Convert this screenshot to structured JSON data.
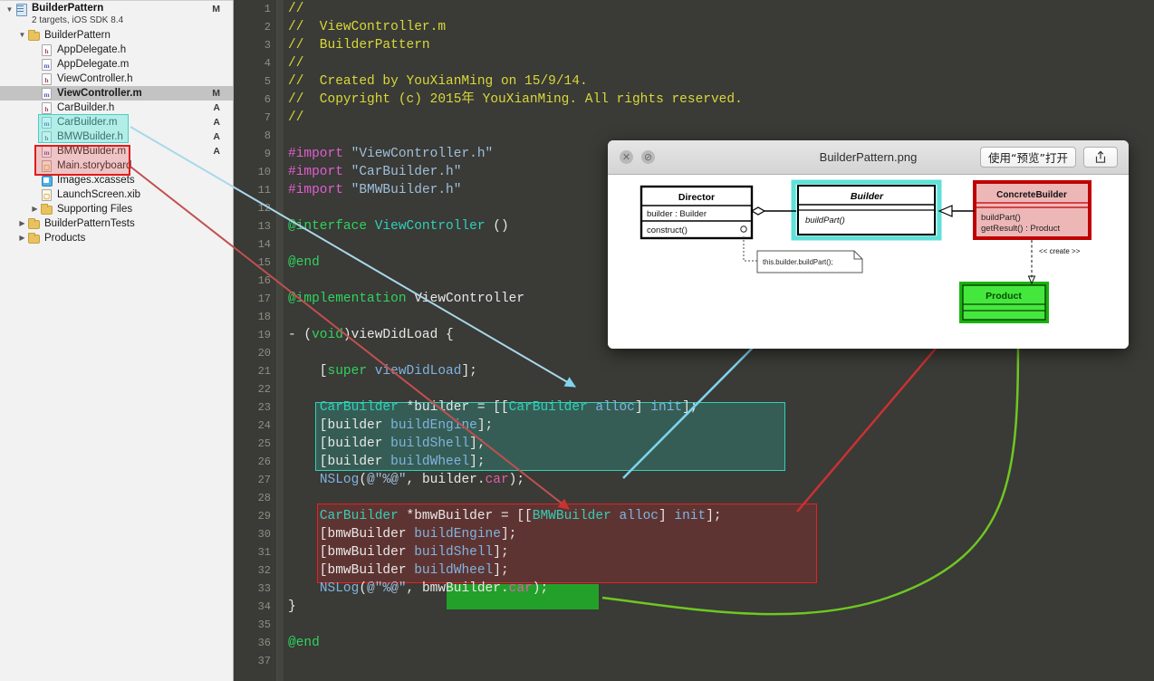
{
  "navigator": {
    "project": {
      "name": "BuilderPattern",
      "subtitle": "2 targets, iOS SDK 8.4",
      "status": "M",
      "icon": "project-icon"
    },
    "items": [
      {
        "label": "BuilderPattern",
        "icon": "folder-icon",
        "indent": 1,
        "status": "",
        "disclosure": "down",
        "selected": false
      },
      {
        "label": "AppDelegate.h",
        "icon": "header-file-icon",
        "indent": 2,
        "status": "",
        "disclosure": "",
        "selected": false
      },
      {
        "label": "AppDelegate.m",
        "icon": "method-file-icon",
        "indent": 2,
        "status": "",
        "disclosure": "",
        "selected": false
      },
      {
        "label": "ViewController.h",
        "icon": "header-file-icon",
        "indent": 2,
        "status": "",
        "disclosure": "",
        "selected": false
      },
      {
        "label": "ViewController.m",
        "icon": "method-file-icon",
        "indent": 2,
        "status": "M",
        "disclosure": "",
        "selected": true
      },
      {
        "label": "CarBuilder.h",
        "icon": "header-file-icon",
        "indent": 2,
        "status": "A",
        "disclosure": "",
        "selected": false
      },
      {
        "label": "CarBuilder.m",
        "icon": "method-file-icon",
        "indent": 2,
        "status": "A",
        "disclosure": "",
        "selected": false
      },
      {
        "label": "BMWBuilder.h",
        "icon": "header-file-icon",
        "indent": 2,
        "status": "A",
        "disclosure": "",
        "selected": false
      },
      {
        "label": "BMWBuilder.m",
        "icon": "method-file-icon",
        "indent": 2,
        "status": "A",
        "disclosure": "",
        "selected": false
      },
      {
        "label": "Main.storyboard",
        "icon": "storyboard-icon",
        "indent": 2,
        "status": "",
        "disclosure": "",
        "selected": false
      },
      {
        "label": "Images.xcassets",
        "icon": "xcassets-icon",
        "indent": 2,
        "status": "",
        "disclosure": "",
        "selected": false
      },
      {
        "label": "LaunchScreen.xib",
        "icon": "xib-icon",
        "indent": 2,
        "status": "",
        "disclosure": "",
        "selected": false
      },
      {
        "label": "Supporting Files",
        "icon": "folder-icon",
        "indent": 2,
        "status": "",
        "disclosure": "right",
        "selected": false
      },
      {
        "label": "BuilderPatternTests",
        "icon": "folder-icon",
        "indent": 1,
        "status": "",
        "disclosure": "right",
        "selected": false
      },
      {
        "label": "Products",
        "icon": "folder-icon",
        "indent": 1,
        "status": "",
        "disclosure": "right",
        "selected": false
      }
    ],
    "highlights": {
      "car_box_color": "#46cfc6",
      "bmw_box_color": "#e01b1b"
    }
  },
  "editor": {
    "first_line": 1,
    "last_line": 37,
    "lines": [
      {
        "n": 1,
        "tokens": [
          {
            "t": "//",
            "c": "cmt"
          }
        ]
      },
      {
        "n": 2,
        "tokens": [
          {
            "t": "//  ViewController.m",
            "c": "cmt"
          }
        ]
      },
      {
        "n": 3,
        "tokens": [
          {
            "t": "//  BuilderPattern",
            "c": "cmt"
          }
        ]
      },
      {
        "n": 4,
        "tokens": [
          {
            "t": "//",
            "c": "cmt"
          }
        ]
      },
      {
        "n": 5,
        "tokens": [
          {
            "t": "//  Created by YouXianMing on 15/9/14.",
            "c": "cmt"
          }
        ]
      },
      {
        "n": 6,
        "tokens": [
          {
            "t": "//  Copyright (c) 2015年 YouXianMing. All rights reserved.",
            "c": "cmt"
          }
        ]
      },
      {
        "n": 7,
        "tokens": [
          {
            "t": "//",
            "c": "cmt"
          }
        ]
      },
      {
        "n": 8,
        "tokens": []
      },
      {
        "n": 9,
        "tokens": [
          {
            "t": "#import",
            "c": "pre"
          },
          {
            "t": " ",
            "c": "pln"
          },
          {
            "t": "\"ViewController.h\"",
            "c": "str"
          }
        ]
      },
      {
        "n": 10,
        "tokens": [
          {
            "t": "#import",
            "c": "pre"
          },
          {
            "t": " ",
            "c": "pln"
          },
          {
            "t": "\"CarBuilder.h\"",
            "c": "str"
          }
        ]
      },
      {
        "n": 11,
        "tokens": [
          {
            "t": "#import",
            "c": "pre"
          },
          {
            "t": " ",
            "c": "pln"
          },
          {
            "t": "\"BMWBuilder.h\"",
            "c": "str"
          }
        ]
      },
      {
        "n": 12,
        "tokens": []
      },
      {
        "n": 13,
        "tokens": [
          {
            "t": "@interface",
            "c": "kw"
          },
          {
            "t": " ",
            "c": "pln"
          },
          {
            "t": "ViewController",
            "c": "typ"
          },
          {
            "t": " ()",
            "c": "pln"
          }
        ]
      },
      {
        "n": 14,
        "tokens": []
      },
      {
        "n": 15,
        "tokens": [
          {
            "t": "@end",
            "c": "kw"
          }
        ]
      },
      {
        "n": 16,
        "tokens": []
      },
      {
        "n": 17,
        "tokens": [
          {
            "t": "@implementation",
            "c": "kw"
          },
          {
            "t": " ViewController",
            "c": "pln"
          }
        ]
      },
      {
        "n": 18,
        "tokens": []
      },
      {
        "n": 19,
        "tokens": [
          {
            "t": "- (",
            "c": "pln"
          },
          {
            "t": "void",
            "c": "kw"
          },
          {
            "t": ")viewDidLoad {",
            "c": "pln"
          }
        ]
      },
      {
        "n": 20,
        "tokens": []
      },
      {
        "n": 21,
        "tokens": [
          {
            "t": "    [",
            "c": "pln"
          },
          {
            "t": "super",
            "c": "kw"
          },
          {
            "t": " ",
            "c": "pln"
          },
          {
            "t": "viewDidLoad",
            "c": "mth"
          },
          {
            "t": "];",
            "c": "pln"
          }
        ]
      },
      {
        "n": 22,
        "tokens": []
      },
      {
        "n": 23,
        "tokens": [
          {
            "t": "    ",
            "c": "pln"
          },
          {
            "t": "CarBuilder",
            "c": "typ"
          },
          {
            "t": " *builder = [[",
            "c": "pln"
          },
          {
            "t": "CarBuilder",
            "c": "typ"
          },
          {
            "t": " ",
            "c": "pln"
          },
          {
            "t": "alloc",
            "c": "mth"
          },
          {
            "t": "] ",
            "c": "pln"
          },
          {
            "t": "init",
            "c": "mth"
          },
          {
            "t": "];",
            "c": "pln"
          }
        ]
      },
      {
        "n": 24,
        "tokens": [
          {
            "t": "    [builder ",
            "c": "pln"
          },
          {
            "t": "buildEngine",
            "c": "mth"
          },
          {
            "t": "];",
            "c": "pln"
          }
        ]
      },
      {
        "n": 25,
        "tokens": [
          {
            "t": "    [builder ",
            "c": "pln"
          },
          {
            "t": "buildShell",
            "c": "mth"
          },
          {
            "t": "];",
            "c": "pln"
          }
        ]
      },
      {
        "n": 26,
        "tokens": [
          {
            "t": "    [builder ",
            "c": "pln"
          },
          {
            "t": "buildWheel",
            "c": "mth"
          },
          {
            "t": "];",
            "c": "pln"
          }
        ]
      },
      {
        "n": 27,
        "tokens": [
          {
            "t": "    ",
            "c": "pln"
          },
          {
            "t": "NSLog",
            "c": "mth"
          },
          {
            "t": "(",
            "c": "pln"
          },
          {
            "t": "@\"%@\"",
            "c": "str"
          },
          {
            "t": ", builder.",
            "c": "pln"
          },
          {
            "t": "car",
            "c": "prop"
          },
          {
            "t": ");",
            "c": "pln"
          }
        ]
      },
      {
        "n": 28,
        "tokens": []
      },
      {
        "n": 29,
        "tokens": [
          {
            "t": "    ",
            "c": "pln"
          },
          {
            "t": "CarBuilder",
            "c": "typ"
          },
          {
            "t": " *bmwBuilder = [[",
            "c": "pln"
          },
          {
            "t": "BMWBuilder",
            "c": "typ"
          },
          {
            "t": " ",
            "c": "pln"
          },
          {
            "t": "alloc",
            "c": "mth"
          },
          {
            "t": "] ",
            "c": "pln"
          },
          {
            "t": "init",
            "c": "mth"
          },
          {
            "t": "];",
            "c": "pln"
          }
        ]
      },
      {
        "n": 30,
        "tokens": [
          {
            "t": "    [bmwBuilder ",
            "c": "pln"
          },
          {
            "t": "buildEngine",
            "c": "mth"
          },
          {
            "t": "];",
            "c": "pln"
          }
        ]
      },
      {
        "n": 31,
        "tokens": [
          {
            "t": "    [bmwBuilder ",
            "c": "pln"
          },
          {
            "t": "buildShell",
            "c": "mth"
          },
          {
            "t": "];",
            "c": "pln"
          }
        ]
      },
      {
        "n": 32,
        "tokens": [
          {
            "t": "    [bmwBuilder ",
            "c": "pln"
          },
          {
            "t": "buildWheel",
            "c": "mth"
          },
          {
            "t": "];",
            "c": "pln"
          }
        ]
      },
      {
        "n": 33,
        "tokens": [
          {
            "t": "    ",
            "c": "pln"
          },
          {
            "t": "NSLog",
            "c": "mth"
          },
          {
            "t": "(",
            "c": "pln"
          },
          {
            "t": "@\"%@\"",
            "c": "str"
          },
          {
            "t": ", bmwBuilder.",
            "c": "pln"
          },
          {
            "t": "car",
            "c": "prop"
          },
          {
            "t": ");",
            "c": "pln"
          }
        ]
      },
      {
        "n": 34,
        "tokens": [
          {
            "t": "}",
            "c": "pln"
          }
        ]
      },
      {
        "n": 35,
        "tokens": []
      },
      {
        "n": 36,
        "tokens": [
          {
            "t": "@end",
            "c": "kw"
          }
        ]
      },
      {
        "n": 37,
        "tokens": []
      }
    ]
  },
  "quicklook": {
    "filename": "BuilderPattern.png",
    "open_with_label": "使用“预览”打开",
    "share_icon": "share-icon",
    "close_icon": "close-icon",
    "fullscreen_icon": "no-fullscreen-icon"
  },
  "uml": {
    "title": "BuilderPattern.png",
    "classes": [
      {
        "id": "director",
        "name": "Director",
        "attributes": [
          "builder : Builder"
        ],
        "operations": [
          "construct()"
        ],
        "header_fill": "#ffffff",
        "border": "#000000"
      },
      {
        "id": "builder",
        "name": "Builder",
        "italic": true,
        "attributes": [],
        "operations": [
          "buildPart()"
        ],
        "header_fill": "#ffffff",
        "border": "#000000",
        "highlight": "#5fe0d8"
      },
      {
        "id": "concretebuilder",
        "name": "ConcreteBuilder",
        "attributes": [],
        "operations": [
          "buildPart()",
          "getResult() : Product"
        ],
        "header_fill": "#eea9a9",
        "border": "#c00000",
        "highlight": "#c00000"
      },
      {
        "id": "product",
        "name": "Product",
        "attributes": [],
        "operations": [],
        "header_fill": "#44e83c",
        "border": "#0a7a06",
        "highlight": "#44e83c"
      }
    ],
    "note": "this.builder.buildPart();",
    "create_label": "<< create >>"
  },
  "annotations": {
    "arrow_cyan_color": "#7fd4ee",
    "arrow_red_color": "#c83232",
    "arrow_green_color": "#6ec822"
  }
}
